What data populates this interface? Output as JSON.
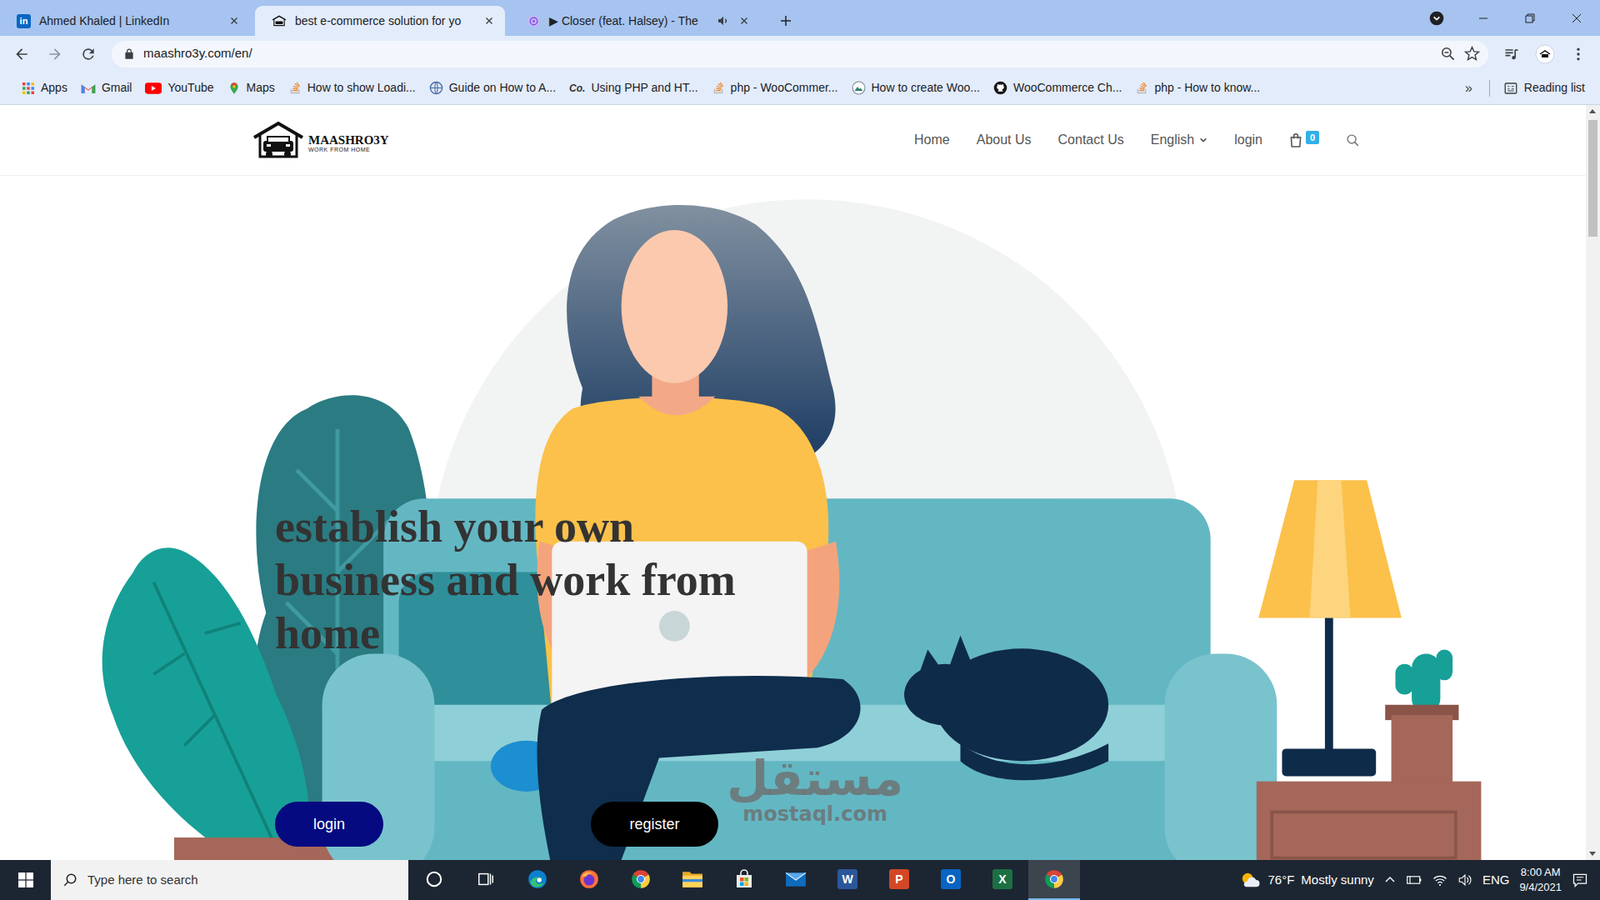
{
  "browser": {
    "tabs": [
      {
        "label": "Ahmed Khaled | LinkedIn",
        "kind": "linkedin",
        "favicon_text": "in",
        "selected": false,
        "audio": false
      },
      {
        "label": "best e-commerce solution for yo",
        "kind": "site",
        "selected": true,
        "audio": false
      },
      {
        "label": "▶ Closer (feat. Halsey) - The",
        "kind": "music",
        "selected": false,
        "audio": true
      }
    ],
    "address": "maashro3y.com/en/",
    "bookmarks": [
      {
        "label": "Apps",
        "kind": "apps"
      },
      {
        "label": "Gmail",
        "kind": "gmail"
      },
      {
        "label": "YouTube",
        "kind": "youtube"
      },
      {
        "label": "Maps",
        "kind": "maps"
      },
      {
        "label": "How to show Loadi...",
        "kind": "stack"
      },
      {
        "label": "Guide on How to A...",
        "kind": "globe"
      },
      {
        "label": "Using PHP and HT...",
        "kind": "text-icon",
        "icon_text": "Co."
      },
      {
        "label": "php - WooCommer...",
        "kind": "stack"
      },
      {
        "label": "How to create Woo...",
        "kind": "mountain"
      },
      {
        "label": "WooCommerce Ch...",
        "kind": "github"
      },
      {
        "label": "php - How to know...",
        "kind": "stack"
      }
    ],
    "bookmarks_more": "»",
    "reading_list": "Reading list"
  },
  "page": {
    "logo": {
      "name": "MAASHRO3Y",
      "tagline": "WORK FROM HOME"
    },
    "nav": [
      {
        "label": "Home",
        "kind": "link"
      },
      {
        "label": "About Us",
        "kind": "link"
      },
      {
        "label": "Contact Us",
        "kind": "link"
      },
      {
        "label": "English",
        "kind": "dropdown"
      },
      {
        "label": "login",
        "kind": "link"
      }
    ],
    "cart_count": "0",
    "hero": {
      "heading": "establish your own business and work from home",
      "buttons": [
        {
          "label": "login",
          "color": "#050a80"
        },
        {
          "label": "register",
          "color": "#000000"
        }
      ]
    }
  },
  "watermark": {
    "text": "مستقل",
    "domain": "mostaql.com"
  },
  "taskbar": {
    "search_placeholder": "Type here to search",
    "apps": [
      {
        "kind": "cortana",
        "selected": false
      },
      {
        "kind": "task-view",
        "selected": false
      },
      {
        "kind": "edge",
        "selected": false
      },
      {
        "kind": "firefox",
        "selected": false
      },
      {
        "kind": "chrome",
        "selected": false
      },
      {
        "kind": "explorer",
        "selected": false
      },
      {
        "kind": "store",
        "selected": false
      },
      {
        "kind": "mail",
        "selected": false
      },
      {
        "kind": "word",
        "letter": "W",
        "selected": false
      },
      {
        "kind": "powerpoint",
        "letter": "P",
        "selected": false
      },
      {
        "kind": "outlook",
        "letter": "O",
        "selected": false
      },
      {
        "kind": "excel",
        "letter": "X",
        "selected": false
      },
      {
        "kind": "chrome",
        "selected": true
      }
    ],
    "weather": {
      "temp": "76°F",
      "summary": "Mostly sunny"
    },
    "language": "ENG",
    "time": "8:00 AM",
    "date": "9/4/2021"
  }
}
